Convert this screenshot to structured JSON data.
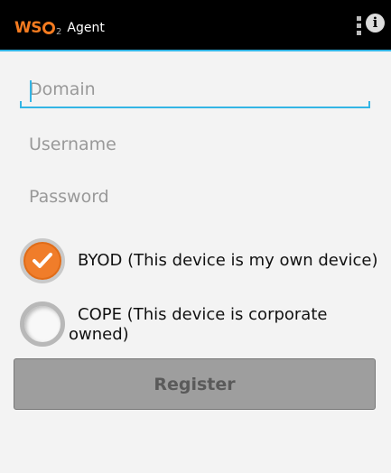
{
  "actionbar": {
    "logo_text": "WSO2",
    "logo_ws": "WS",
    "logo_sub": "2",
    "title": "Agent",
    "menu_icon": "overflow-menu-icon",
    "info_icon": "info-icon",
    "info_glyph": "i",
    "accent_color": "#33b5e5"
  },
  "form": {
    "domain_placeholder": "Domain",
    "username_placeholder": "Username",
    "password_placeholder": "Password",
    "focused_field": "domain"
  },
  "ownership": {
    "options": [
      {
        "label": "BYOD (This device is my own device)",
        "checked": true
      },
      {
        "label": "COPE (This device is corporate owned)",
        "checked": false
      }
    ],
    "checked_color": "#f07d2a"
  },
  "register_label": "Register"
}
